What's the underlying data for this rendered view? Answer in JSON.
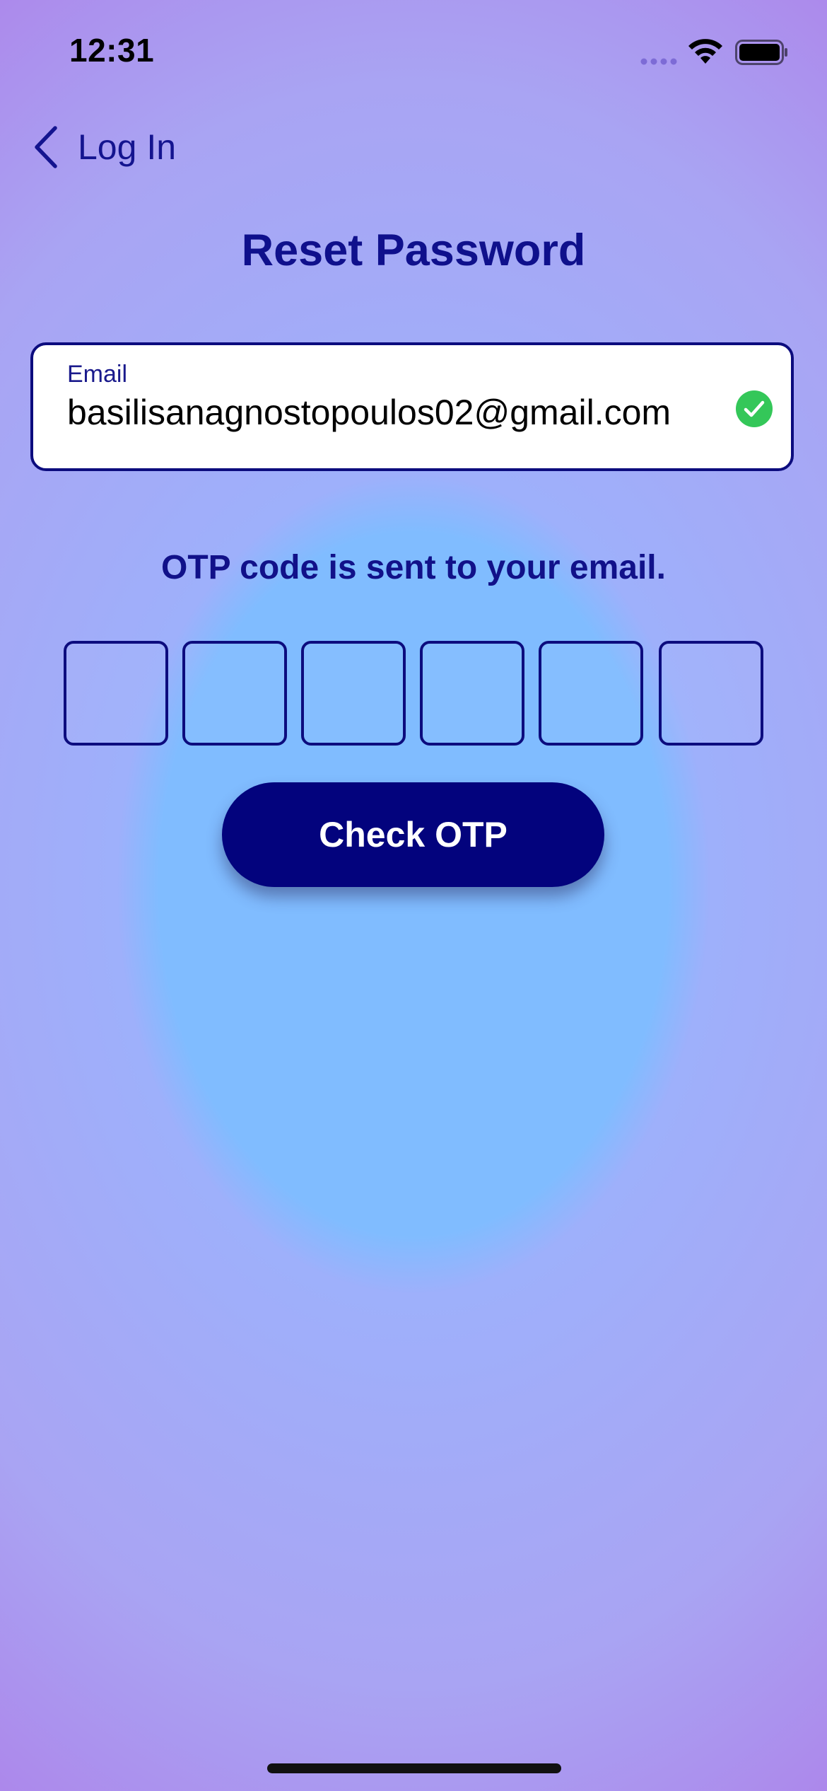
{
  "status_bar": {
    "time": "12:31",
    "icons": [
      "signal-icon",
      "wifi-icon",
      "battery-icon"
    ]
  },
  "nav": {
    "back_label": "Log In",
    "back_icon": "chevron-left-icon"
  },
  "page": {
    "title": "Reset Password"
  },
  "email_field": {
    "label": "Email",
    "value": "basilisanagnostopoulos02@gmail.com",
    "status_icon": "check-circle-icon",
    "status_color": "#34c759"
  },
  "otp": {
    "hint": "OTP code is sent to your email.",
    "digits": [
      "",
      "",
      "",
      "",
      "",
      ""
    ]
  },
  "actions": {
    "check_otp_label": "Check OTP"
  },
  "colors": {
    "primary": "#03037d",
    "accent_text": "#0f108c",
    "background_center": "#80bcff",
    "background_edge": "#b069e2"
  }
}
